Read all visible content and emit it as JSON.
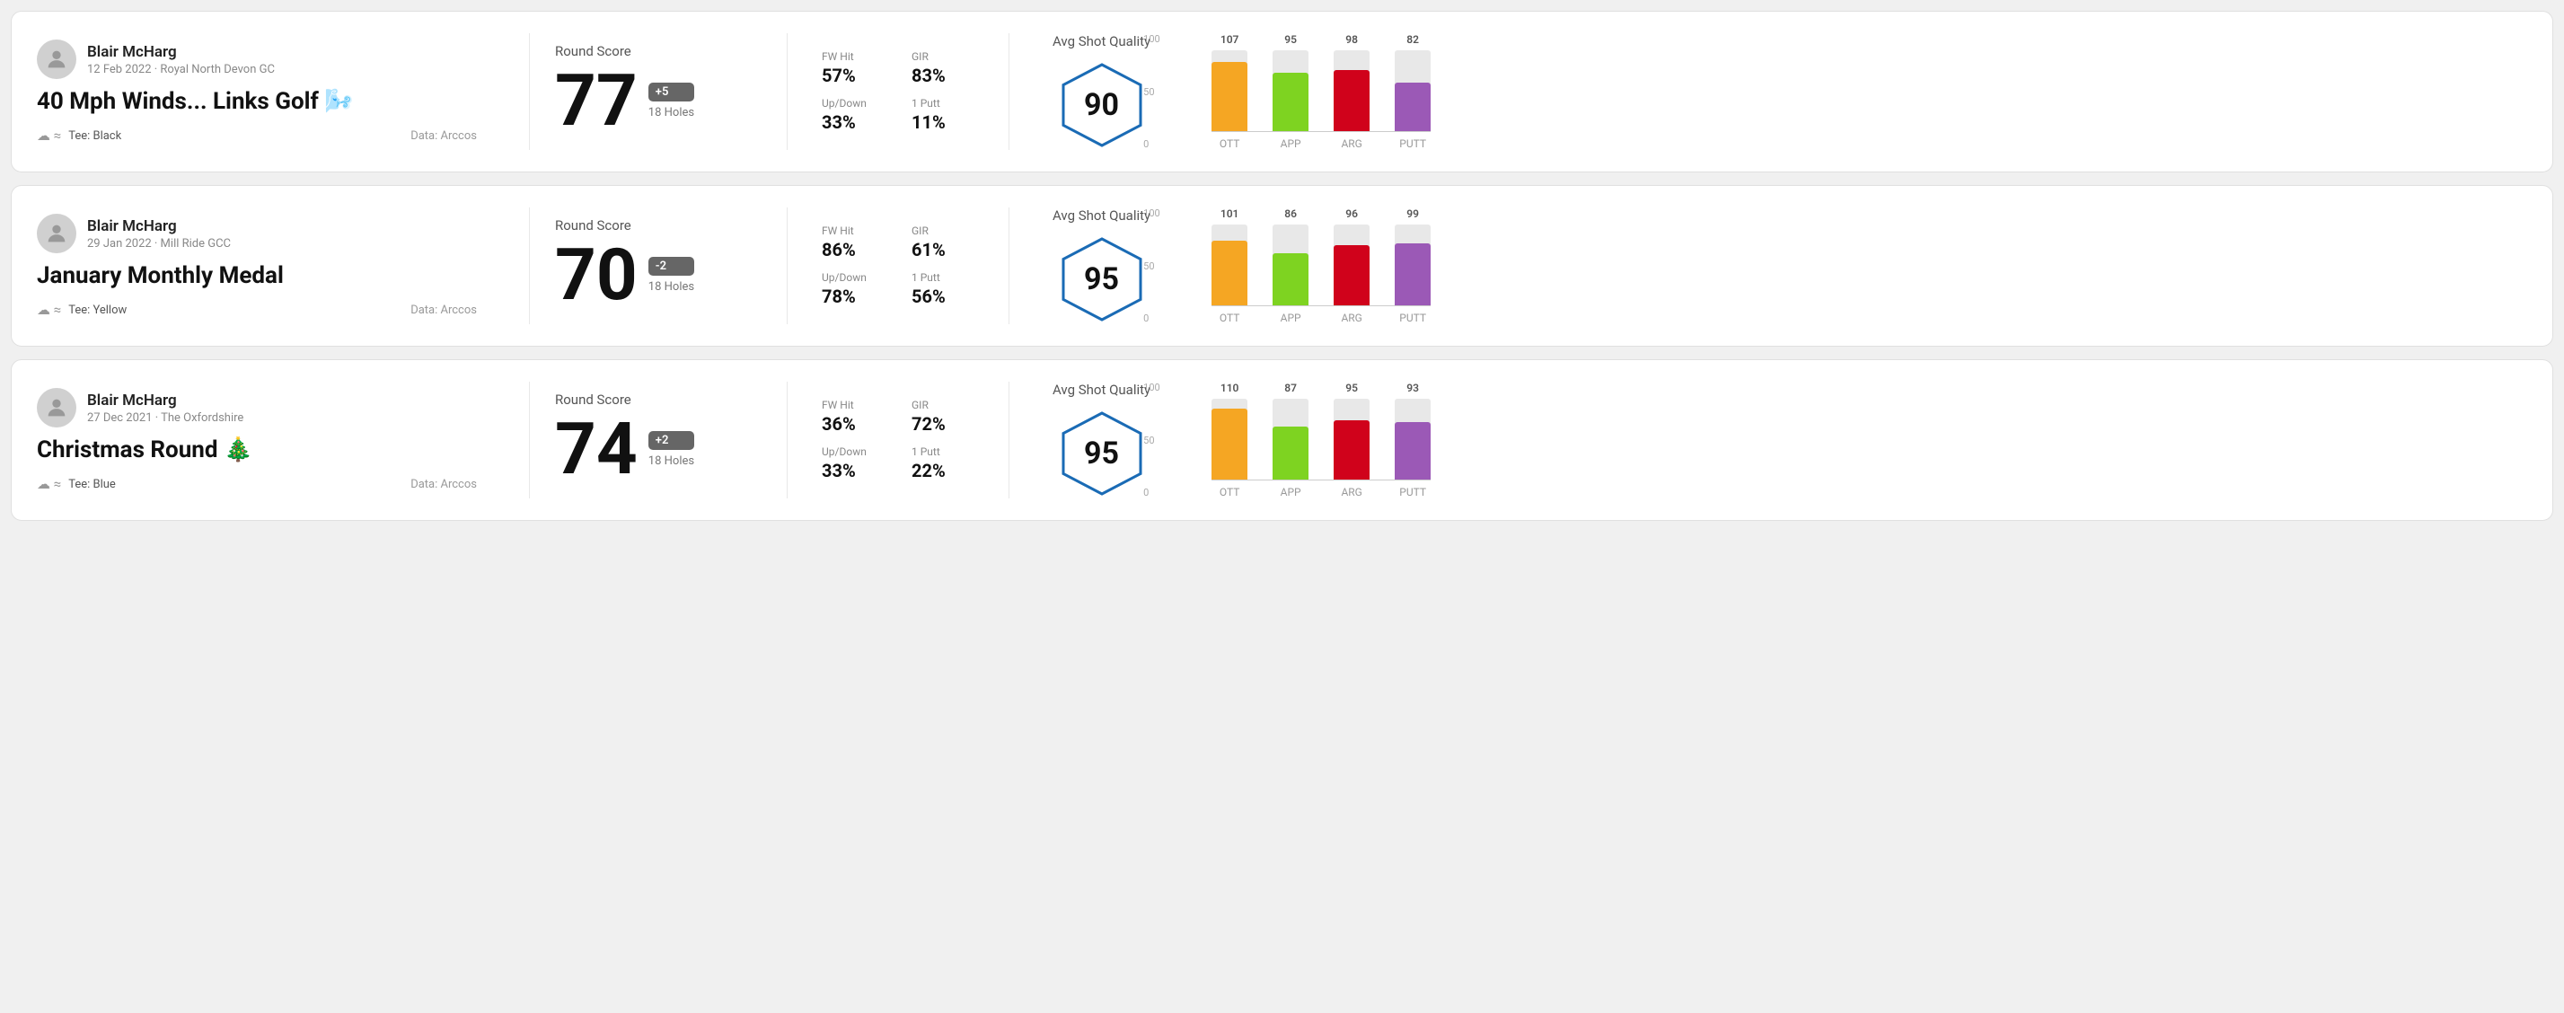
{
  "rounds": [
    {
      "id": "round1",
      "user": {
        "name": "Blair McHarg",
        "meta": "12 Feb 2022 · Royal North Devon GC"
      },
      "title": "40 Mph Winds... Links Golf 🌬️",
      "tee": "Black",
      "data_source": "Data: Arccos",
      "score": {
        "number": "77",
        "badge": "+5",
        "badge_type": "positive",
        "holes": "18 Holes"
      },
      "stats": {
        "fw_hit_label": "FW Hit",
        "fw_hit_value": "57%",
        "gir_label": "GIR",
        "gir_value": "83%",
        "updown_label": "Up/Down",
        "updown_value": "33%",
        "oneputt_label": "1 Putt",
        "oneputt_value": "11%"
      },
      "quality": {
        "label": "Avg Shot Quality",
        "score": "90",
        "bars": [
          {
            "label": "OTT",
            "value": 107,
            "color": "#f5a623",
            "height_pct": 85
          },
          {
            "label": "APP",
            "value": 95,
            "color": "#7ed321",
            "height_pct": 72
          },
          {
            "label": "ARG",
            "value": 98,
            "color": "#d0021b",
            "height_pct": 75
          },
          {
            "label": "PUTT",
            "value": 82,
            "color": "#9b59b6",
            "height_pct": 60
          }
        ]
      }
    },
    {
      "id": "round2",
      "user": {
        "name": "Blair McHarg",
        "meta": "29 Jan 2022 · Mill Ride GCC"
      },
      "title": "January Monthly Medal",
      "tee": "Yellow",
      "data_source": "Data: Arccos",
      "score": {
        "number": "70",
        "badge": "-2",
        "badge_type": "negative",
        "holes": "18 Holes"
      },
      "stats": {
        "fw_hit_label": "FW Hit",
        "fw_hit_value": "86%",
        "gir_label": "GIR",
        "gir_value": "61%",
        "updown_label": "Up/Down",
        "updown_value": "78%",
        "oneputt_label": "1 Putt",
        "oneputt_value": "56%"
      },
      "quality": {
        "label": "Avg Shot Quality",
        "score": "95",
        "bars": [
          {
            "label": "OTT",
            "value": 101,
            "color": "#f5a623",
            "height_pct": 80
          },
          {
            "label": "APP",
            "value": 86,
            "color": "#7ed321",
            "height_pct": 64
          },
          {
            "label": "ARG",
            "value": 96,
            "color": "#d0021b",
            "height_pct": 74
          },
          {
            "label": "PUTT",
            "value": 99,
            "color": "#9b59b6",
            "height_pct": 77
          }
        ]
      }
    },
    {
      "id": "round3",
      "user": {
        "name": "Blair McHarg",
        "meta": "27 Dec 2021 · The Oxfordshire"
      },
      "title": "Christmas Round 🎄",
      "tee": "Blue",
      "data_source": "Data: Arccos",
      "score": {
        "number": "74",
        "badge": "+2",
        "badge_type": "positive",
        "holes": "18 Holes"
      },
      "stats": {
        "fw_hit_label": "FW Hit",
        "fw_hit_value": "36%",
        "gir_label": "GIR",
        "gir_value": "72%",
        "updown_label": "Up/Down",
        "updown_value": "33%",
        "oneputt_label": "1 Putt",
        "oneputt_value": "22%"
      },
      "quality": {
        "label": "Avg Shot Quality",
        "score": "95",
        "bars": [
          {
            "label": "OTT",
            "value": 110,
            "color": "#f5a623",
            "height_pct": 88
          },
          {
            "label": "APP",
            "value": 87,
            "color": "#7ed321",
            "height_pct": 65
          },
          {
            "label": "ARG",
            "value": 95,
            "color": "#d0021b",
            "height_pct": 73
          },
          {
            "label": "PUTT",
            "value": 93,
            "color": "#9b59b6",
            "height_pct": 71
          }
        ]
      }
    }
  ],
  "y_axis_labels": [
    "100",
    "50",
    "0"
  ]
}
